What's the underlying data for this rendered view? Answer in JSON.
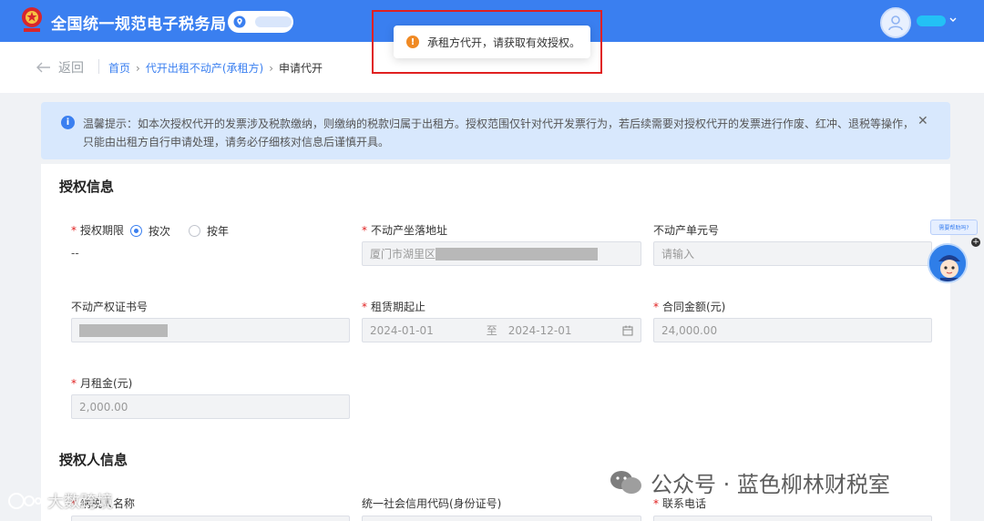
{
  "header": {
    "title": "全国统一规范电子税务局",
    "brand_color": "#3a7ff0"
  },
  "nav": {
    "back_label": "返回",
    "breadcrumb": [
      "首页",
      "代开出租不动产(承租方)",
      "申请代开"
    ]
  },
  "toast": {
    "message": "承租方代开，请获取有效授权。",
    "icon": "warning-icon"
  },
  "notice": {
    "line1": "温馨提示：如本次授权代开的发票涉及税款缴纳，则缴纳的税款归属于出租方。授权范围仅针对代开发票行为，若后续需要对授权代开的发票进行作废、红冲、退税等操作，",
    "line2": "只能由出租方自行申请处理，请务必仔细核对信息后谨慎开具。"
  },
  "auth_info": {
    "title": "授权信息",
    "period_label": "授权期限",
    "period_options": [
      "按次",
      "按年"
    ],
    "period_selected": "按次",
    "period_value": "--",
    "address_label": "不动产坐落地址",
    "address_value": "厦门市湖里区",
    "unit_label": "不动产单元号",
    "unit_placeholder": "请输入",
    "cert_label": "不动产权证书号",
    "lease_label": "租赁期起止",
    "lease_start": "2024-01-01",
    "lease_to": "至",
    "lease_end": "2024-12-01",
    "contract_label": "合同金额(元)",
    "contract_value": "24,000.00",
    "monthly_label": "月租金(元)",
    "monthly_value": "2,000.00"
  },
  "authorizer_info": {
    "title": "授权人信息",
    "name_label": "纳税人名称",
    "credit_label": "统一社会信用代码(身份证号)",
    "phone_label": "联系电话"
  },
  "help": {
    "bubble": "需要帮助吗?"
  },
  "watermark": {
    "right": "公众号 · 蓝色柳林财税室",
    "left": "大数跨境"
  }
}
